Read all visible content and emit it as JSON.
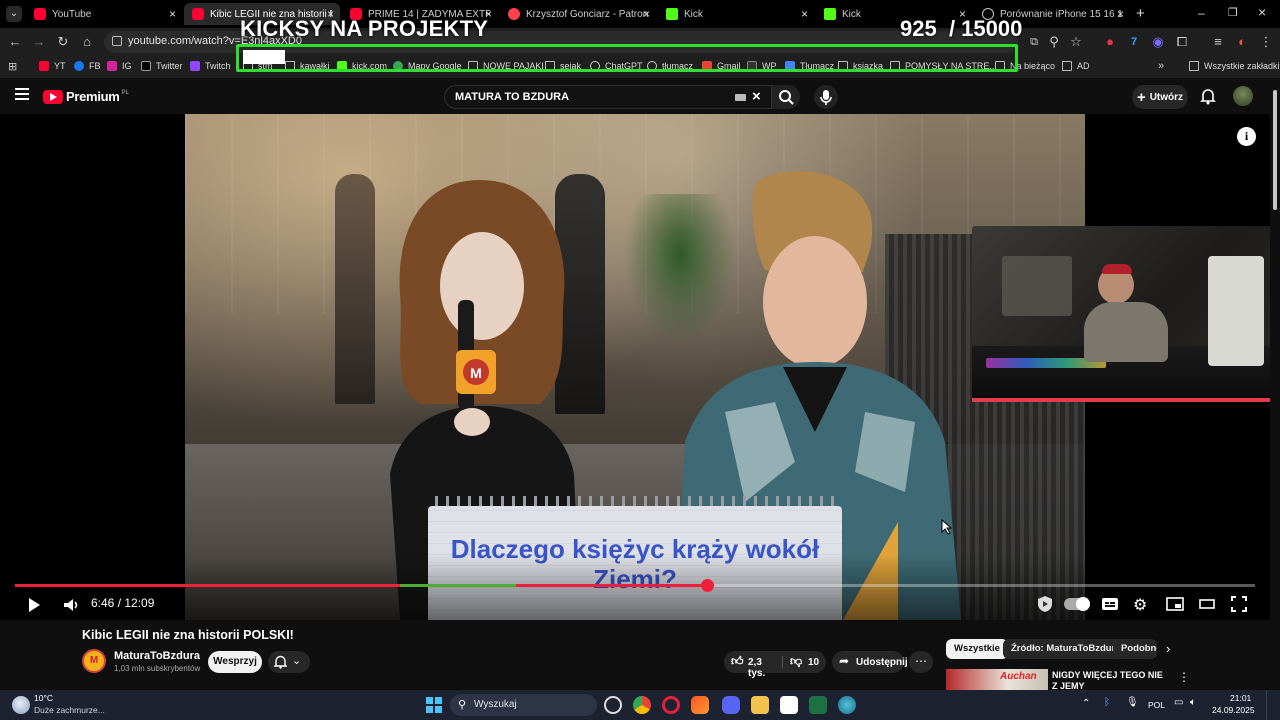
{
  "browser": {
    "tabs": [
      {
        "title": "YouTube",
        "favicon": "youtube-icon"
      },
      {
        "title": "Kibic LEGII nie zna historii POLSKI!",
        "favicon": "youtube-icon",
        "active": true
      },
      {
        "title": "PRIME 14 | ZADYMA EXTRA: M",
        "favicon": "youtube-icon"
      },
      {
        "title": "Krzysztof Gonciarz - Patronite.p",
        "favicon": "patronite-icon"
      },
      {
        "title": "Kick",
        "favicon": "kick-icon"
      },
      {
        "title": "Kick",
        "favicon": "kick-icon"
      },
      {
        "title": "Porównanie iPhone 15 16 17 P",
        "favicon": "globe-icon"
      }
    ],
    "url": "youtube.com/watch?v=E3nl4axXD0",
    "bookmarks": [
      "YT",
      "FB",
      "IG",
      "Twitter",
      "Twitch",
      "stm",
      "kawałki",
      "kick.com",
      "Mapy Google",
      "NOWE PAJAKI",
      "sejak",
      "ChatGPT",
      "tłumacz",
      "Gmail",
      "WP",
      "Tłumacz",
      "ksiazka",
      "POMYSŁY NA STRE...",
      "Na bieżąco",
      "AD"
    ],
    "all_bookmarks": "Wszystkie zakładki"
  },
  "overlay": {
    "title": "KICKSY NA PROJEKTY",
    "count": "925",
    "goal": "/ 15000"
  },
  "youtube": {
    "logo": "Premium",
    "logo_region": "PL",
    "search_query": "MATURA TO BZDURA",
    "create_label": "Utwórz"
  },
  "video": {
    "calendar_text": "Dlaczego księżyc krąży wokół Ziemi?",
    "mic_logo": "M",
    "current_time": "6:46",
    "duration": "12:09",
    "time_display": "6:46 / 12:09",
    "progress_fraction": 0.557
  },
  "details": {
    "title": "Kibic LEGII nie zna historii POLSKI!",
    "channel": "MaturaToBzdura",
    "subscribers": "1,03 mln subskrybentów",
    "support_label": "Wesprzyj",
    "likes": "2,3 tys.",
    "dislikes": "10",
    "share_label": "Udostępnij"
  },
  "recommendations": {
    "chips": [
      "Wszystkie",
      "Źródło: MaturaToBzdura",
      "Podobne"
    ],
    "first_title": "NIGDY WIĘCEJ TEGO NIE Z JEMY",
    "first_thumb_text": "Auchan"
  },
  "taskbar": {
    "temperature": "10°C",
    "weather": "Duże zachmurze...",
    "search_placeholder": "Wyszukaj",
    "language": "POL",
    "time": "21:01",
    "date": "24.09.2025"
  },
  "colors": {
    "accent_red": "#f0203a",
    "overlay_green": "#2ee02e",
    "progress_green": "#4caf32"
  }
}
